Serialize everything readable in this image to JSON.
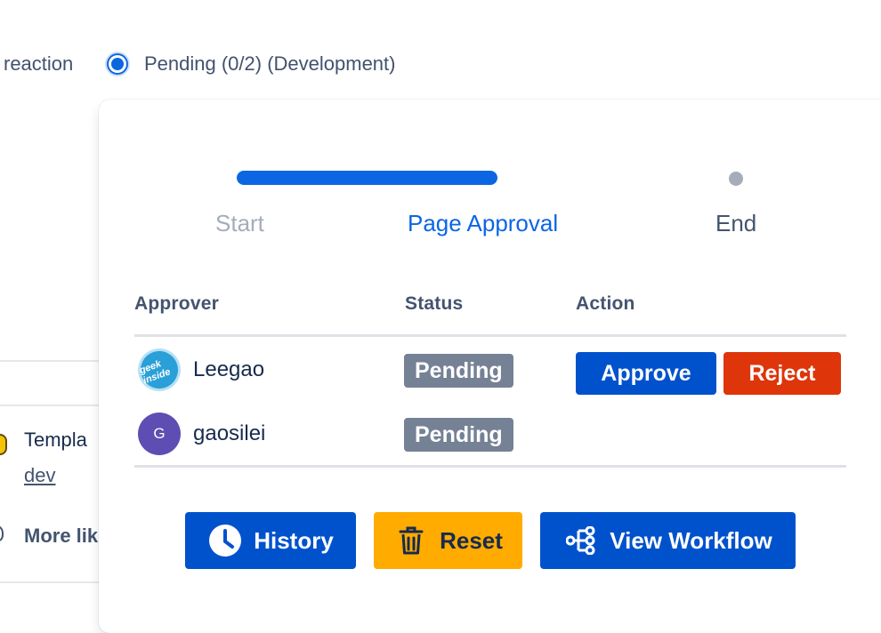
{
  "background": {
    "status_prefix": "reaction",
    "status_text": "Pending (0/2) (Development)",
    "template_text": "Templa",
    "link_text": "dev",
    "more_text": "More lik"
  },
  "workflow": {
    "steps": [
      "Start",
      "Page Approval",
      "End"
    ],
    "current_step": "Page Approval"
  },
  "table": {
    "headers": {
      "approver": "Approver",
      "status": "Status",
      "action": "Action"
    },
    "rows": [
      {
        "name": "Leegao",
        "status": "Pending",
        "avatar_text": "geek inside",
        "actions": [
          "Approve",
          "Reject"
        ]
      },
      {
        "name": "gaosilei",
        "status": "Pending",
        "avatar_text": "G"
      }
    ]
  },
  "footer": {
    "history_label": "History",
    "reset_label": "Reset",
    "workflow_label": "View Workflow"
  },
  "icons": {
    "history": "clock-icon",
    "reset": "trash-icon",
    "workflow": "workflow-tree-icon"
  },
  "colors": {
    "primary": "#0052cc",
    "progress": "#0c66e4",
    "danger": "#de350b",
    "warning": "#ffab00",
    "badge": "#758195"
  }
}
